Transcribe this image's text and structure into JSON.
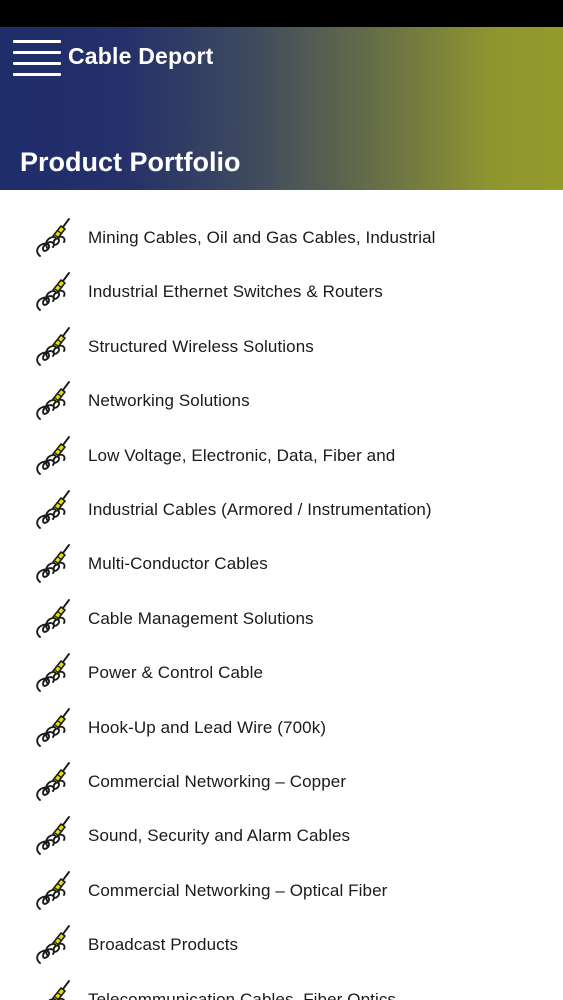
{
  "header": {
    "app_title": "Cable Deport",
    "page_title": "Product Portfolio",
    "menu_icon": "hamburger-menu-icon"
  },
  "colors": {
    "header_gradient_start": "#1f2d6b",
    "header_gradient_end": "#959a2c",
    "icon_accent": "#e8e000",
    "text": "#1a1a1a"
  },
  "list": {
    "icon": "cable-connector-icon",
    "items": [
      {
        "label": "Mining Cables, Oil and Gas Cables, Industrial"
      },
      {
        "label": "Industrial Ethernet Switches & Routers"
      },
      {
        "label": "Structured Wireless Solutions"
      },
      {
        "label": "Networking Solutions"
      },
      {
        "label": "Low Voltage, Electronic, Data, Fiber and"
      },
      {
        "label": "Industrial Cables (Armored / Instrumentation)"
      },
      {
        "label": "Multi-Conductor Cables"
      },
      {
        "label": "Cable Management Solutions"
      },
      {
        "label": "Power & Control Cable"
      },
      {
        "label": "Hook-Up and Lead Wire (700k)"
      },
      {
        "label": "Commercial Networking – Copper"
      },
      {
        "label": "Sound, Security and Alarm Cables"
      },
      {
        "label": "Commercial Networking – Optical Fiber"
      },
      {
        "label": "Broadcast Products"
      },
      {
        "label": "Telecommunication Cables, Fiber Optics"
      }
    ]
  }
}
